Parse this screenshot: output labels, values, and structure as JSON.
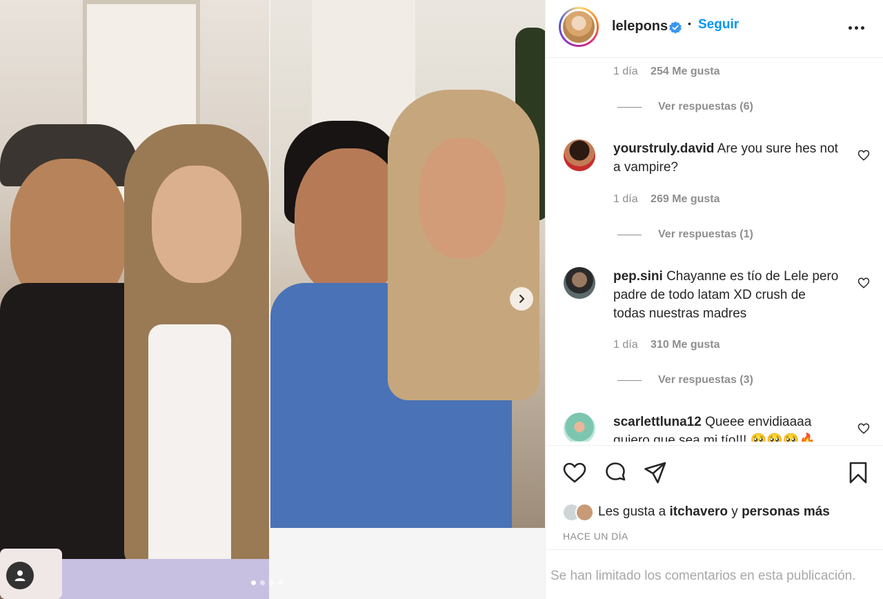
{
  "post": {
    "username": "lelepons",
    "follow_label": "Seguir",
    "separator": "•"
  },
  "comments": [
    {
      "partial": true,
      "time": "1 día",
      "likes": "254 Me gusta",
      "replies": "Ver respuestas (6)"
    },
    {
      "username": "yourstruly.david",
      "text": "Are you sure hes not a vampire?",
      "time": "1 día",
      "likes": "269 Me gusta",
      "replies": "Ver respuestas (1)"
    },
    {
      "username": "pep.sini",
      "text": "Chayanne es tío de Lele pero padre de todo latam XD crush de todas nuestras madres",
      "time": "1 día",
      "likes": "310 Me gusta",
      "replies": "Ver respuestas (3)"
    },
    {
      "username": "scarlettluna12",
      "text": "Queee envidiaaaa quiero que sea mi tío!!! 🥺🥺🥺🔥"
    }
  ],
  "liked_by": {
    "prefix": "Les gusta a",
    "user": "itchavero",
    "conj": "y",
    "others": "personas más"
  },
  "time_ago": "HACE UN DÍA",
  "comments_limited": "Se han limitado los comentarios en esta publicación.",
  "carousel": {
    "total": 4,
    "active": 1
  },
  "icons": [
    "verified-badge-icon",
    "more-options-icon",
    "heart-icon",
    "comment-icon",
    "share-icon",
    "bookmark-icon",
    "chevron-right-icon",
    "user-tag-icon"
  ],
  "colors": {
    "accent": "#0095f6",
    "secondary_text": "#8e8e8e",
    "primary_text": "#262626"
  }
}
